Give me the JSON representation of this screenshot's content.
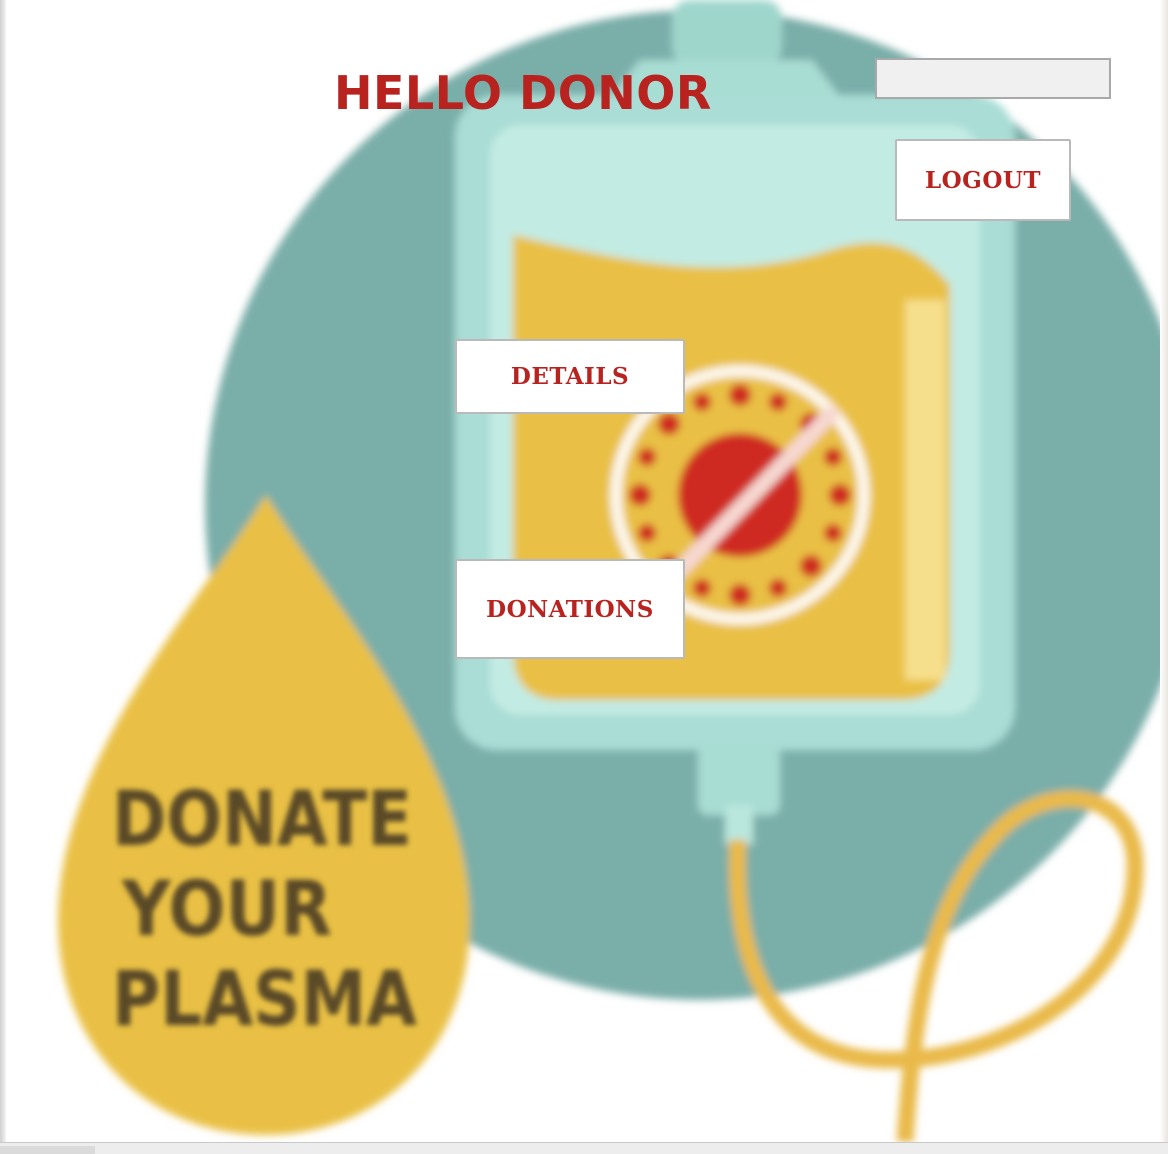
{
  "header": {
    "title": "HELLO DONOR"
  },
  "name_field": {
    "value": ""
  },
  "buttons": {
    "logout": "LOGOUT",
    "details": "DETAILS",
    "donations": "DONATIONS"
  },
  "background": {
    "poster_text_line1": "DONATE",
    "poster_text_line2": "YOUR",
    "poster_text_line3": "PLASMA"
  },
  "colors": {
    "accent_red": "#b8231f",
    "teal_circle": "#7aaea9",
    "plasma_yellow": "#e9c044"
  }
}
